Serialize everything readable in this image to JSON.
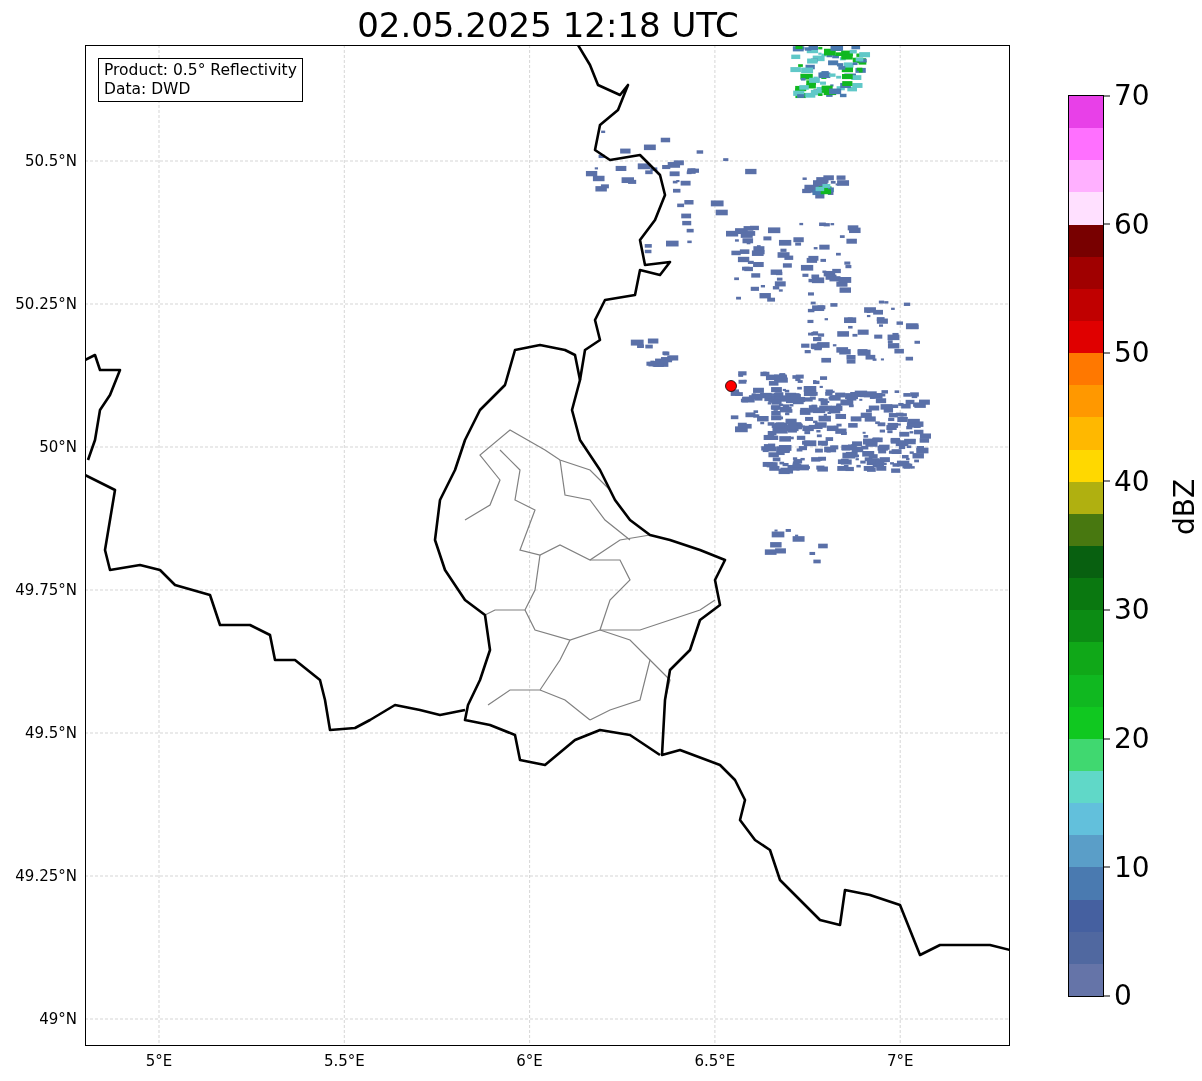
{
  "title": "02.05.2025 12:18 UTC",
  "map": {
    "info_box": [
      "Product: 0.5° Reflectivity",
      "Data: DWD"
    ],
    "lat_ticks": [
      "50.5°N",
      "50.25°N",
      "50°N",
      "49.75°N",
      "49.5°N",
      "49.25°N",
      "49°N"
    ],
    "lon_ticks": [
      "5°E",
      "5.5°E",
      "6°E",
      "6.5°E",
      "7°E"
    ]
  },
  "colorbar": {
    "label": "dBZ",
    "ticks": [
      "70",
      "60",
      "50",
      "40",
      "30",
      "20",
      "10",
      "0"
    ],
    "segments": [
      {
        "color": "#6574a8"
      },
      {
        "color": "#5068a0"
      },
      {
        "color": "#4560a0"
      },
      {
        "color": "#4a7ab0"
      },
      {
        "color": "#5a9ec8"
      },
      {
        "color": "#62c0dc"
      },
      {
        "color": "#60d8c8"
      },
      {
        "color": "#40d870"
      },
      {
        "color": "#10c820"
      },
      {
        "color": "#10b820"
      },
      {
        "color": "#10a818"
      },
      {
        "color": "#0c8c14"
      },
      {
        "color": "#0a7810"
      },
      {
        "color": "#086010"
      },
      {
        "color": "#487810"
      },
      {
        "color": "#b0b010"
      },
      {
        "color": "#ffd800"
      },
      {
        "color": "#ffb800"
      },
      {
        "color": "#ff9800"
      },
      {
        "color": "#ff7800"
      },
      {
        "color": "#e00000"
      },
      {
        "color": "#c00000"
      },
      {
        "color": "#a00000"
      },
      {
        "color": "#780000"
      },
      {
        "color": "#ffe0ff"
      },
      {
        "color": "#ffb0ff"
      },
      {
        "color": "#ff70ff"
      },
      {
        "color": "#e840e8"
      }
    ]
  }
}
